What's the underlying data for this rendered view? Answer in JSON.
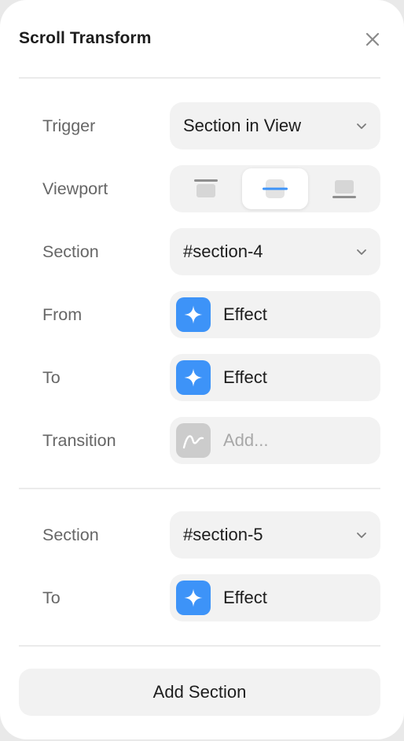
{
  "title": "Scroll Transform",
  "colors": {
    "accent": "#3d93f8",
    "muted_badge": "#cccccc"
  },
  "icons": {
    "close": "close-icon",
    "chevron": "chevron-down-icon",
    "effect": "sparkle-icon",
    "transition": "curve-icon",
    "viewport_top": "viewport-top-icon",
    "viewport_center": "viewport-center-icon",
    "viewport_bottom": "viewport-bottom-icon"
  },
  "rows": {
    "trigger": {
      "label": "Trigger",
      "value": "Section in View"
    },
    "viewport": {
      "label": "Viewport",
      "selected": "center",
      "options": [
        "top",
        "center",
        "bottom"
      ]
    },
    "section1": {
      "label": "Section",
      "value": "#section-4"
    },
    "from": {
      "label": "From",
      "value": "Effect"
    },
    "to1": {
      "label": "To",
      "value": "Effect"
    },
    "transition": {
      "label": "Transition",
      "placeholder": "Add..."
    },
    "section2": {
      "label": "Section",
      "value": "#section-5"
    },
    "to2": {
      "label": "To",
      "value": "Effect"
    }
  },
  "add_section_label": "Add Section"
}
